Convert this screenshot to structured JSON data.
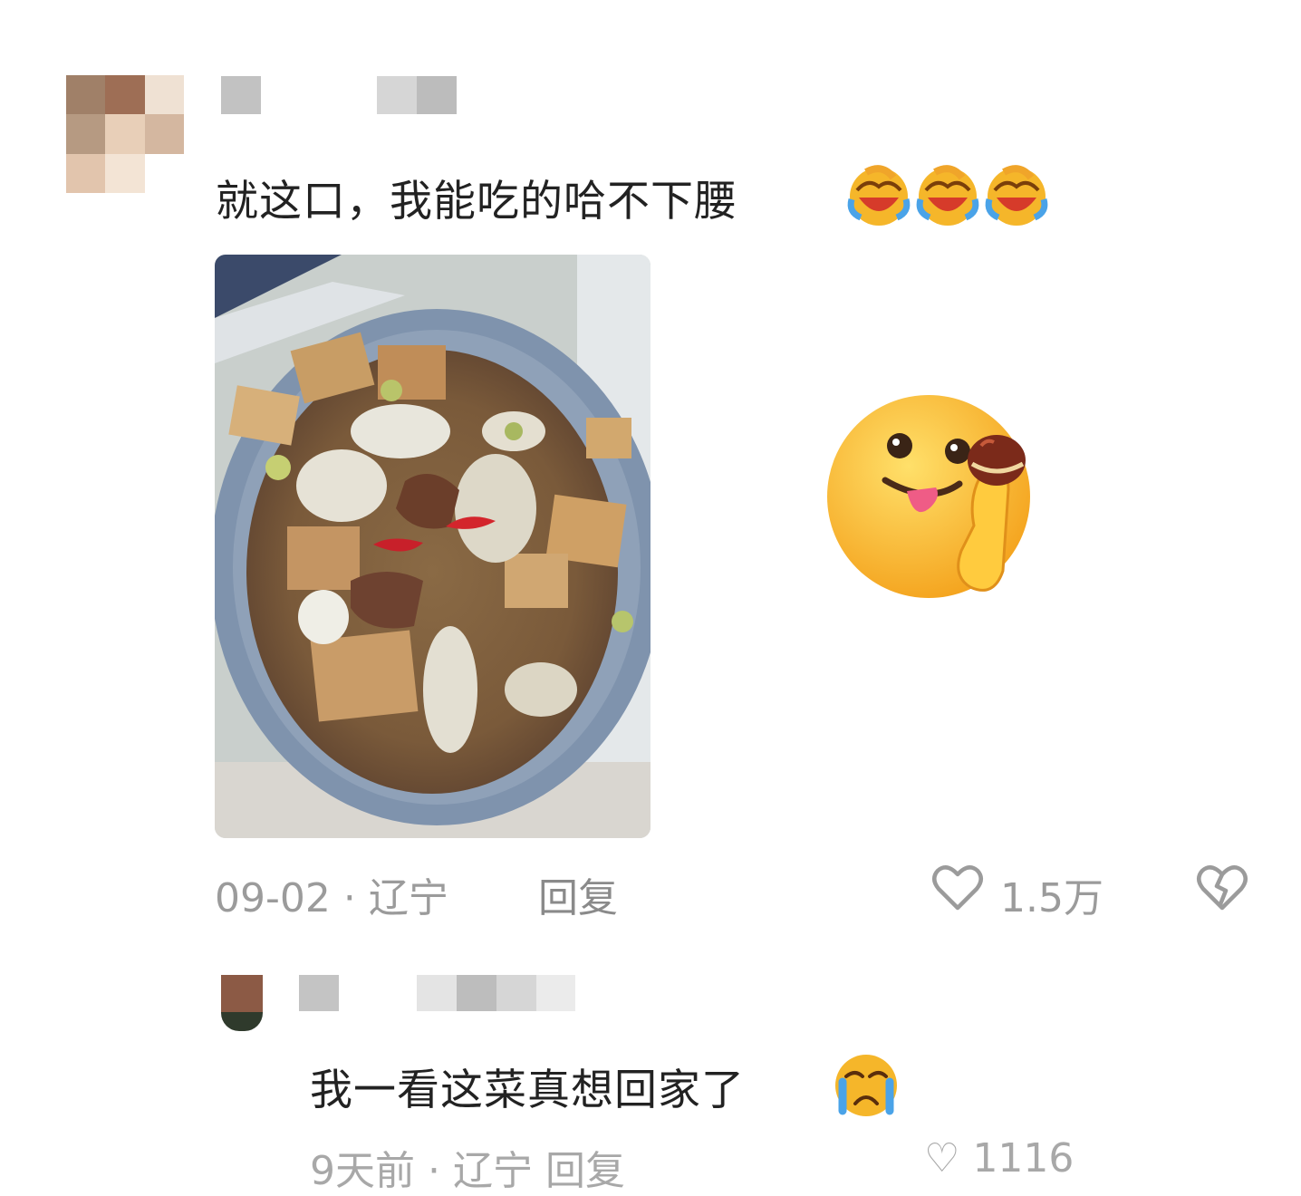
{
  "comment": {
    "text": "就这口，我能吃的哈不下腰",
    "emoji": "loudly-laughing-emoji",
    "emoji_count": 3,
    "date": "09-02",
    "separator": " · ",
    "location": "辽宁",
    "reply_label": "回复",
    "like_count": "1.5万"
  },
  "sticker": {
    "name": "tongue-out-face-thumbs-up-chestnut-sticker"
  },
  "reply": {
    "text": "我一看这菜真想回家了",
    "emoji": "crying-face-emoji"
  },
  "bottom_row": {
    "partial_meta": "9天前 · 辽宁    回复",
    "partial_like": "1116"
  },
  "colors": {
    "text": "#222222",
    "meta": "#9b9b9b",
    "background": "#ffffff"
  }
}
